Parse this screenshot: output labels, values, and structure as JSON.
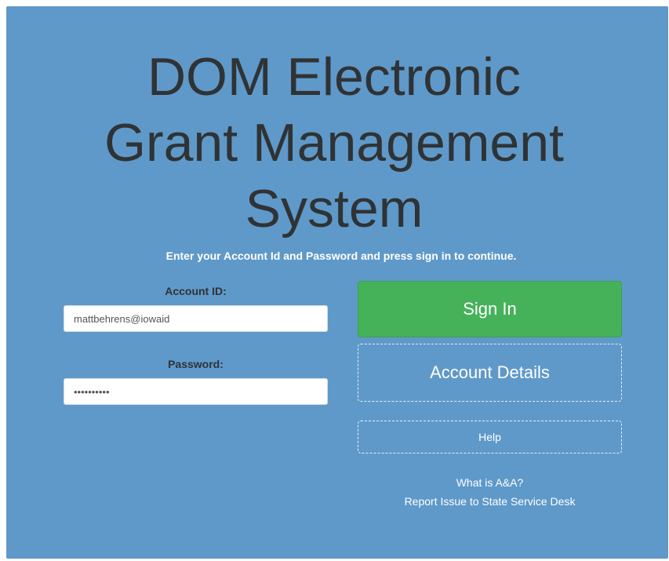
{
  "title": {
    "line1": "DOM Electronic",
    "line2": "Grant Management",
    "line3": "System"
  },
  "instructions": "Enter your Account Id and Password and press sign in to continue.",
  "form": {
    "account_id_label": "Account ID:",
    "account_id_value": "mattbehrens@iowaid",
    "password_label": "Password:",
    "password_value": "••••••••••"
  },
  "buttons": {
    "sign_in": "Sign In",
    "account_details": "Account Details",
    "help": "Help"
  },
  "links": {
    "what_is": "What is A&A?",
    "report_issue": "Report Issue to State Service Desk"
  },
  "colors": {
    "panel_background": "#5f99c9",
    "primary_button": "#45b25a",
    "title_text": "#2f3335"
  }
}
